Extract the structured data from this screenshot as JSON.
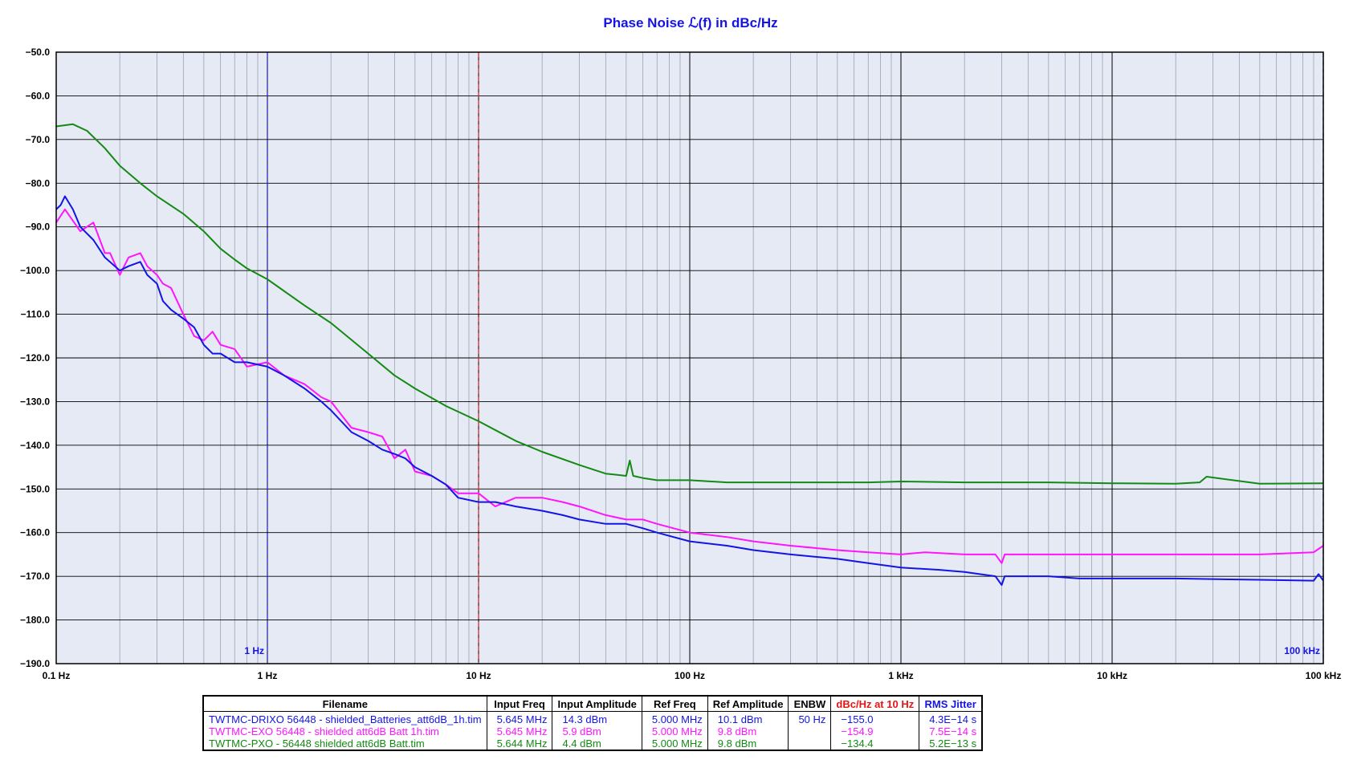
{
  "chart_data": {
    "type": "line",
    "title": "Phase Noise ℒ(f) in dBc/Hz",
    "title_color": "#1414e6",
    "x_scale": "log",
    "xlim": [
      0.1,
      100000
    ],
    "ylim": [
      -190,
      -50
    ],
    "grid": true,
    "plot_background": "#e6eaf5",
    "x_tick_labels": [
      {
        "value": 0.1,
        "label": "0.1 Hz"
      },
      {
        "value": 1,
        "label": "1 Hz"
      },
      {
        "value": 10,
        "label": "10 Hz"
      },
      {
        "value": 100,
        "label": "100 Hz"
      },
      {
        "value": 1000,
        "label": "1 kHz"
      },
      {
        "value": 10000,
        "label": "10 kHz"
      },
      {
        "value": 100000,
        "label": "100 kHz"
      }
    ],
    "y_tick_labels": [
      {
        "value": -50,
        "label": "−50.0"
      },
      {
        "value": -60,
        "label": "−60.0"
      },
      {
        "value": -70,
        "label": "−70.0"
      },
      {
        "value": -80,
        "label": "−80.0"
      },
      {
        "value": -90,
        "label": "−90.0"
      },
      {
        "value": -100,
        "label": "−100.0"
      },
      {
        "value": -110,
        "label": "−110.0"
      },
      {
        "value": -120,
        "label": "−120.0"
      },
      {
        "value": -130,
        "label": "−130.0"
      },
      {
        "value": -140,
        "label": "−140.0"
      },
      {
        "value": -150,
        "label": "−150.0"
      },
      {
        "value": -160,
        "label": "−160.0"
      },
      {
        "value": -170,
        "label": "−170.0"
      },
      {
        "value": -180,
        "label": "−180.0"
      },
      {
        "value": -190,
        "label": "−190.0"
      }
    ],
    "markers": [
      {
        "x": 1,
        "label": "1 Hz",
        "color": "#1414e6"
      },
      {
        "x": 10,
        "label": "",
        "color": "#e61414"
      },
      {
        "x": 100000,
        "label": "100 kHz",
        "color": "#1414e6"
      }
    ],
    "series": [
      {
        "name": "TWTMC-PXO - 56448  shielded att6dB Batt.tim",
        "color": "#138a13",
        "x": [
          0.1,
          0.12,
          0.14,
          0.17,
          0.2,
          0.25,
          0.3,
          0.4,
          0.5,
          0.6,
          0.7,
          0.8,
          1,
          1.5,
          2,
          3,
          4,
          5,
          7,
          10,
          15,
          20,
          30,
          40,
          50,
          52,
          54,
          60,
          70,
          100,
          150,
          200,
          300,
          500,
          700,
          1000,
          2000,
          3000,
          5000,
          10000,
          20000,
          26000,
          28000,
          50000,
          100000
        ],
        "y": [
          -67,
          -66.5,
          -68,
          -72,
          -76,
          -80,
          -83,
          -87,
          -91,
          -95,
          -97.5,
          -99.5,
          -102,
          -108,
          -112,
          -119,
          -124,
          -127,
          -131,
          -134.5,
          -139,
          -141.5,
          -144.5,
          -146.5,
          -147,
          -143.5,
          -147,
          -147.5,
          -148,
          -148,
          -148.5,
          -148.5,
          -148.5,
          -148.5,
          -148.5,
          -148.3,
          -148.5,
          -148.5,
          -148.5,
          -148.7,
          -148.8,
          -148.5,
          -147.2,
          -148.8,
          -148.7
        ]
      },
      {
        "name": "TWTMC-EXO 56448  - shielded att6dB Batt 1h.tim",
        "color": "#ff14ff",
        "x": [
          0.1,
          0.11,
          0.13,
          0.15,
          0.17,
          0.18,
          0.2,
          0.22,
          0.25,
          0.27,
          0.3,
          0.32,
          0.35,
          0.4,
          0.45,
          0.5,
          0.55,
          0.6,
          0.7,
          0.8,
          1,
          1.2,
          1.5,
          1.8,
          2,
          2.5,
          3,
          3.5,
          4,
          4.5,
          5,
          6,
          7,
          8,
          10,
          12,
          15,
          20,
          25,
          30,
          40,
          50,
          60,
          70,
          100,
          150,
          200,
          300,
          500,
          700,
          1000,
          1300,
          2000,
          2800,
          3000,
          3100,
          5000,
          10000,
          50000,
          90000,
          100000
        ],
        "y": [
          -89,
          -86,
          -91,
          -89,
          -96,
          -96,
          -101,
          -97,
          -96,
          -99,
          -101,
          -103,
          -104,
          -110,
          -115,
          -116,
          -114,
          -117,
          -118,
          -122,
          -121,
          -124,
          -126,
          -129,
          -130,
          -136,
          -137,
          -138,
          -143,
          -141,
          -146,
          -147,
          -149,
          -151,
          -151,
          -154,
          -152,
          -152,
          -153,
          -154,
          -156,
          -157,
          -157,
          -158,
          -160,
          -161,
          -162,
          -163,
          -164,
          -164.5,
          -165,
          -164.5,
          -165,
          -165,
          -167,
          -165,
          -165,
          -165,
          -165,
          -164.5,
          -163
        ]
      },
      {
        "name": "TWTMC-DRIXO  56448  - shielded_Batteries_att6dB_1h.tim",
        "color": "#1414e6",
        "x": [
          0.1,
          0.105,
          0.11,
          0.12,
          0.13,
          0.15,
          0.17,
          0.2,
          0.22,
          0.25,
          0.27,
          0.3,
          0.32,
          0.35,
          0.4,
          0.45,
          0.5,
          0.55,
          0.6,
          0.7,
          0.8,
          1,
          1.2,
          1.5,
          1.8,
          2,
          2.5,
          3,
          3.5,
          4,
          4.5,
          5,
          6,
          7,
          8,
          10,
          12,
          15,
          20,
          25,
          30,
          40,
          50,
          60,
          70,
          100,
          150,
          200,
          300,
          500,
          700,
          1000,
          1500,
          2000,
          2800,
          3000,
          3100,
          5000,
          7000,
          10000,
          20000,
          50000,
          90000,
          95000,
          100000
        ],
        "y": [
          -86,
          -85,
          -83,
          -86,
          -90,
          -93,
          -97,
          -100,
          -99,
          -98,
          -101,
          -103,
          -107,
          -109,
          -111,
          -113,
          -117,
          -119,
          -119,
          -121,
          -121,
          -122,
          -124,
          -127,
          -130,
          -132,
          -137,
          -139,
          -141,
          -142,
          -143,
          -145,
          -147,
          -149,
          -152,
          -153,
          -153,
          -154,
          -155,
          -156,
          -157,
          -158,
          -158,
          -159,
          -160,
          -162,
          -163,
          -164,
          -165,
          -166,
          -167,
          -168,
          -168.5,
          -169,
          -170,
          -172,
          -170,
          -170,
          -170.5,
          -170.5,
          -170.5,
          -170.8,
          -171,
          -169.5,
          -171
        ]
      }
    ],
    "table": {
      "columns": [
        "Filename",
        "Input Freq",
        "Input Amplitude",
        "Ref Freq",
        "Ref Amplitude",
        "ENBW",
        "dBc/Hz at 10 Hz",
        "RMS Jitter"
      ],
      "header_colors": [
        "#000000",
        "#000000",
        "#000000",
        "#000000",
        "#000000",
        "#000000",
        "#e61414",
        "#1414e6"
      ],
      "rows": [
        {
          "color": "#1414e6",
          "cells": [
            "TWTMC-DRIXO  56448  - shielded_Batteries_att6dB_1h.tim",
            "5.645 MHz",
            "14.3 dBm",
            "5.000 MHz",
            "10.1 dBm",
            "50 Hz",
            "−155.0",
            "4.3E−14 s"
          ]
        },
        {
          "color": "#ff14ff",
          "cells": [
            "TWTMC-EXO 56448  - shielded att6dB Batt 1h.tim",
            "5.645 MHz",
            "5.9 dBm",
            "5.000 MHz",
            "9.8 dBm",
            "",
            "−154.9",
            "7.5E−14 s"
          ]
        },
        {
          "color": "#138a13",
          "cells": [
            "TWTMC-PXO - 56448  shielded att6dB Batt.tim",
            "5.644 MHz",
            "4.4 dBm",
            "5.000 MHz",
            "9.8 dBm",
            "",
            "−134.4",
            "5.2E−13 s"
          ]
        }
      ]
    }
  }
}
